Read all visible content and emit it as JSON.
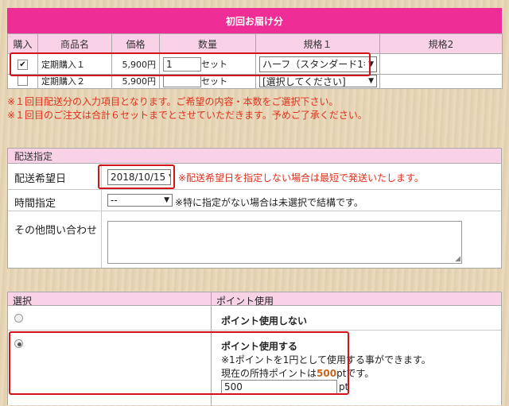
{
  "order": {
    "title": "初回お届け分",
    "headers": [
      "購入",
      "商品名",
      "価格",
      "数量",
      "規格１",
      "規格2"
    ],
    "rows": [
      {
        "checked": true,
        "name": "定期購入１",
        "price": "5,900円",
        "qty": "1",
        "unit": "セット",
        "spec1": "ハーフ（スタンダード1ｷ",
        "spec2": ""
      },
      {
        "checked": false,
        "name": "定期購入２",
        "price": "5,900円",
        "qty": "",
        "unit": "セット",
        "spec1": "[選択してください]",
        "spec2": ""
      }
    ],
    "notes": [
      "※１回目配送分の入力項目となります。ご希望の内容・本数をご選択下さい。",
      "※１回目のご注文は合計６セットまでとさせていただきます。予めご了承ください。"
    ]
  },
  "delivery": {
    "title": "配送指定",
    "date_label": "配送希望日",
    "date_value": "2018/10/15",
    "date_note": "※配送希望日を指定しない場合は最短で発送いたします。",
    "time_label": "時間指定",
    "time_value": "--",
    "time_note": "※特に指定がない場合は未選択で結構です。",
    "inquiry_label": "その他問い合わせ"
  },
  "points": {
    "col_select": "選択",
    "col_use": "ポイント使用",
    "option_none": "ポイント使用しない",
    "option_use": "ポイント使用する",
    "note1": "※1ポイントを1円として使用する事ができます。",
    "note2_prefix": "現在の所持ポイントは",
    "note2_value": "500",
    "note2_suffix": "ptです。",
    "input_value": "500",
    "input_unit": "pt"
  },
  "colors": {
    "accent": "#ee2e96",
    "header_bg": "#fad2e8",
    "note": "#e0301e",
    "highlight": "#d3131a",
    "points_value": "#c8641c"
  }
}
